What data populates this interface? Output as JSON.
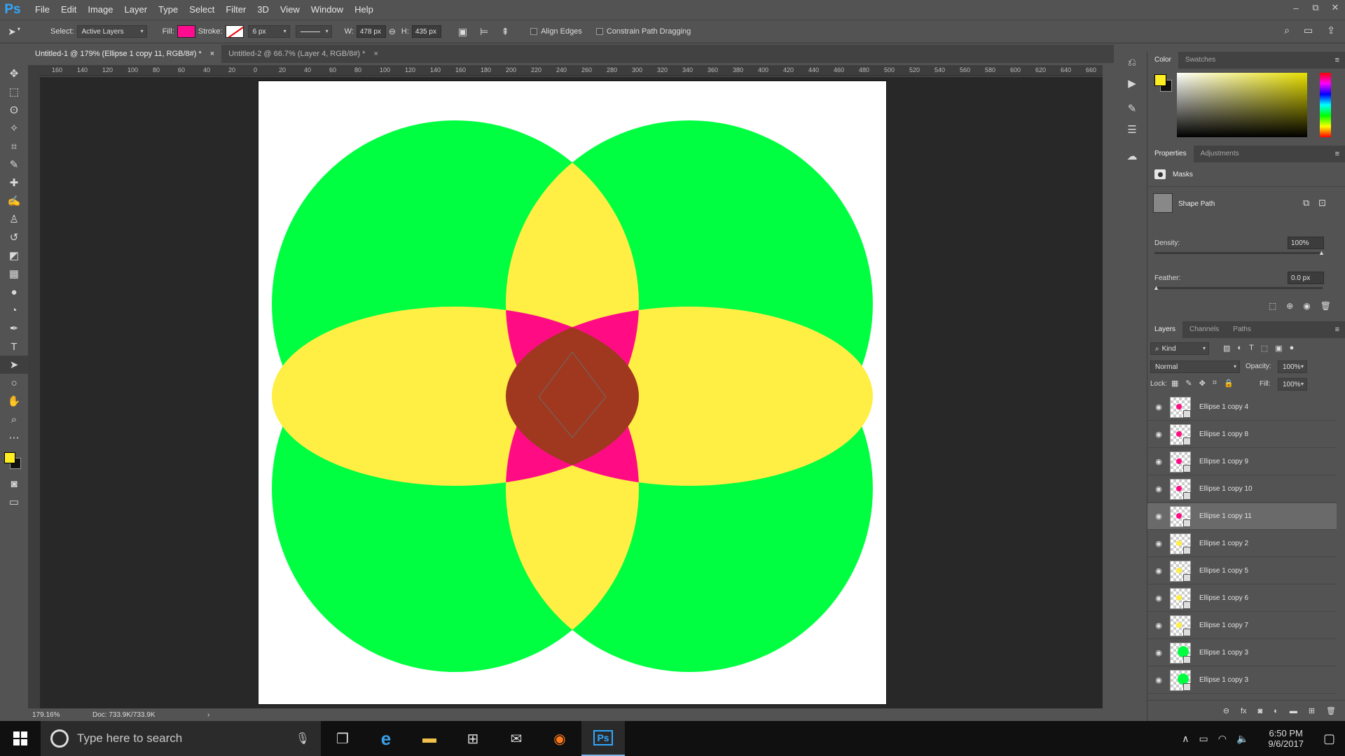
{
  "app": {
    "logo": "Ps"
  },
  "menu": [
    "File",
    "Edit",
    "Image",
    "Layer",
    "Type",
    "Select",
    "Filter",
    "3D",
    "View",
    "Window",
    "Help"
  ],
  "window_controls": [
    "–",
    "⧉",
    "✕"
  ],
  "options": {
    "select_label": "Select:",
    "select_value": "Active Layers",
    "fill_label": "Fill:",
    "fill_color": "#ff0c90",
    "stroke_label": "Stroke:",
    "stroke_size": "6 px",
    "w_label": "W:",
    "w_value": "478 px",
    "h_label": "H:",
    "h_value": "435 px",
    "align_edges": "Align Edges",
    "constrain": "Constrain Path Dragging"
  },
  "tabs": [
    {
      "label": "Untitled-1 @ 179% (Ellipse 1 copy 11, RGB/8#) *",
      "close": "×"
    },
    {
      "label": "Untitled-2 @ 66.7% (Layer 4, RGB/8#) *",
      "close": "×"
    }
  ],
  "ruler_h": [
    "160",
    "140",
    "120",
    "100",
    "80",
    "60",
    "40",
    "20",
    "0",
    "20",
    "40",
    "60",
    "80",
    "100",
    "120",
    "140",
    "160",
    "180",
    "200",
    "220",
    "240",
    "260",
    "280",
    "300",
    "320",
    "340",
    "360",
    "380",
    "400",
    "420",
    "440",
    "460",
    "480",
    "500",
    "520",
    "540",
    "560",
    "580",
    "600",
    "620",
    "640",
    "660"
  ],
  "status": {
    "zoom": "179.16%",
    "doc": "Doc: 733.9K/733.9K",
    "arrow": "›"
  },
  "colors": {
    "green": "#00ff40",
    "yellow": "#ffee44",
    "magenta": "#ff0c85",
    "brown": "#a0381f",
    "fg": "#ffee22",
    "bg": "#111111"
  },
  "color_panel": {
    "tabs": [
      "Color",
      "Swatches"
    ]
  },
  "properties": {
    "tabs": [
      "Properties",
      "Adjustments"
    ],
    "masks_label": "Masks",
    "shape_path_label": "Shape Path",
    "density_label": "Density:",
    "density_value": "100%",
    "feather_label": "Feather:",
    "feather_value": "0.0 px"
  },
  "layers_panel": {
    "tabs": [
      "Layers",
      "Channels",
      "Paths"
    ],
    "kind": "Kind",
    "blend": "Normal",
    "opacity_label": "Opacity:",
    "opacity_value": "100%",
    "lock_label": "Lock:",
    "fill_label": "Fill:",
    "fill_value": "100%",
    "layers": [
      {
        "name": "Ellipse 1 copy 4",
        "thumb": "magenta"
      },
      {
        "name": "Ellipse 1 copy 8",
        "thumb": "magenta"
      },
      {
        "name": "Ellipse 1 copy 9",
        "thumb": "magenta"
      },
      {
        "name": "Ellipse 1 copy 10",
        "thumb": "magenta"
      },
      {
        "name": "Ellipse 1 copy 11",
        "thumb": "magenta",
        "selected": true
      },
      {
        "name": "Ellipse 1 copy 2",
        "thumb": "yellow"
      },
      {
        "name": "Ellipse 1 copy 5",
        "thumb": "yellow"
      },
      {
        "name": "Ellipse 1 copy 6",
        "thumb": "yellow"
      },
      {
        "name": "Ellipse 1 copy 7",
        "thumb": "yellow"
      },
      {
        "name": "Ellipse 1 copy 3",
        "thumb": "green"
      },
      {
        "name": "Ellipse 1 copy 3",
        "thumb": "green"
      }
    ]
  },
  "taskbar": {
    "search_placeholder": "Type here to search",
    "time": "6:50 PM",
    "date": "9/6/2017",
    "ps_label": "Ps"
  }
}
